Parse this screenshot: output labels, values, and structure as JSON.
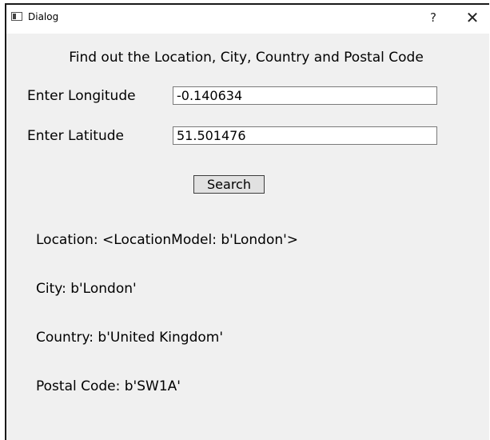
{
  "window": {
    "title": "Dialog",
    "help_label": "?",
    "close_label": "✕"
  },
  "form": {
    "heading": "Find out the Location, City, Country and Postal Code",
    "longitude_label": "Enter Longitude",
    "longitude_value": "-0.140634",
    "latitude_label": "Enter Latitude",
    "latitude_value": "51.501476",
    "search_label": "Search"
  },
  "results": {
    "location": "Location: <LocationModel: b'London'>",
    "city": "City: b'London'",
    "country": "Country: b'United Kingdom'",
    "postal_code": "Postal Code: b'SW1A'"
  },
  "colors": {
    "window_bg": "#f0f0f0",
    "titlebar_bg": "#ffffff",
    "button_bg": "#e1e1e1"
  }
}
